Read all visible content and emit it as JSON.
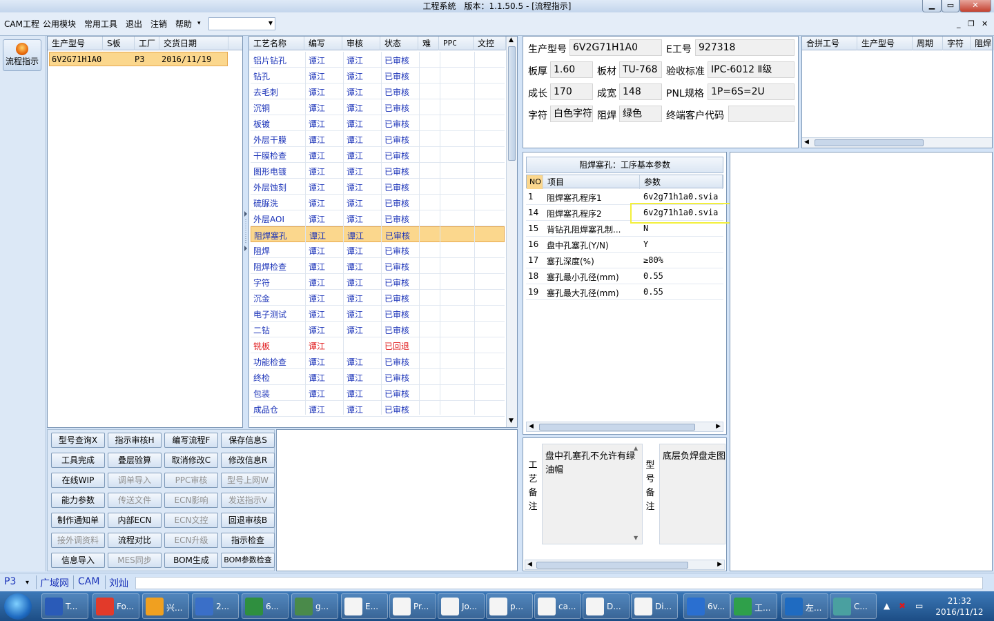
{
  "window": {
    "title": "工程系统　版本：1.1.50.5 - [流程指示]",
    "min_label": "▁",
    "max_label": "▭",
    "close_label": "✕"
  },
  "menu": {
    "items": [
      "CAM工程",
      "公用模块",
      "常用工具",
      "退出",
      "注销",
      "帮助"
    ],
    "help_arrow": "▾",
    "combo_value": "",
    "mdi_min": "_",
    "mdi_restore": "❐",
    "mdi_close": "✕"
  },
  "left_toolbar": {
    "flow_button": "流程指示"
  },
  "product_list": {
    "columns": [
      "生产型号",
      "S板",
      "工厂",
      "交货日期"
    ],
    "rows": [
      {
        "model": "6V2G71H1A0",
        "s_board": "",
        "factory": "P3",
        "delivery": "2016/11/19"
      }
    ]
  },
  "process_table": {
    "columns": [
      "工艺名称",
      "编写",
      "审核",
      "状态",
      "难",
      "PPC",
      "文控"
    ],
    "selected_index": 11,
    "rows": [
      {
        "name": "铝片钻孔",
        "writer": "谭江",
        "reviewer": "谭江",
        "status": "已审核"
      },
      {
        "name": "钻孔",
        "writer": "谭江",
        "reviewer": "谭江",
        "status": "已审核"
      },
      {
        "name": "去毛刺",
        "writer": "谭江",
        "reviewer": "谭江",
        "status": "已审核"
      },
      {
        "name": "沉铜",
        "writer": "谭江",
        "reviewer": "谭江",
        "status": "已审核"
      },
      {
        "name": "板镀",
        "writer": "谭江",
        "reviewer": "谭江",
        "status": "已审核"
      },
      {
        "name": "外层干膜",
        "writer": "谭江",
        "reviewer": "谭江",
        "status": "已审核"
      },
      {
        "name": "干膜检查",
        "writer": "谭江",
        "reviewer": "谭江",
        "status": "已审核"
      },
      {
        "name": "图形电镀",
        "writer": "谭江",
        "reviewer": "谭江",
        "status": "已审核"
      },
      {
        "name": "外层蚀刻",
        "writer": "谭江",
        "reviewer": "谭江",
        "status": "已审核"
      },
      {
        "name": "硫脲洗",
        "writer": "谭江",
        "reviewer": "谭江",
        "status": "已审核"
      },
      {
        "name": "外层AOI",
        "writer": "谭江",
        "reviewer": "谭江",
        "status": "已审核"
      },
      {
        "name": "阻焊塞孔",
        "writer": "谭江",
        "reviewer": "谭江",
        "status": "已审核"
      },
      {
        "name": "阻焊",
        "writer": "谭江",
        "reviewer": "谭江",
        "status": "已审核"
      },
      {
        "name": "阻焊检查",
        "writer": "谭江",
        "reviewer": "谭江",
        "status": "已审核"
      },
      {
        "name": "字符",
        "writer": "谭江",
        "reviewer": "谭江",
        "status": "已审核"
      },
      {
        "name": "沉金",
        "writer": "谭江",
        "reviewer": "谭江",
        "status": "已审核"
      },
      {
        "name": "电子测试",
        "writer": "谭江",
        "reviewer": "谭江",
        "status": "已审核"
      },
      {
        "name": "二钻",
        "writer": "谭江",
        "reviewer": "谭江",
        "status": "已审核"
      },
      {
        "name": "铣板",
        "writer": "谭江",
        "reviewer": "",
        "status": "已回退",
        "returned": true
      },
      {
        "name": "功能检查",
        "writer": "谭江",
        "reviewer": "谭江",
        "status": "已审核"
      },
      {
        "name": "终检",
        "writer": "谭江",
        "reviewer": "谭江",
        "status": "已审核"
      },
      {
        "name": "包装",
        "writer": "谭江",
        "reviewer": "谭江",
        "status": "已审核"
      },
      {
        "name": "成品仓",
        "writer": "谭江",
        "reviewer": "谭江",
        "status": "已审核"
      }
    ]
  },
  "info": {
    "prod_model_label": "生产型号",
    "prod_model": "6V2G71H1A0",
    "e_no_label": "E工号",
    "e_no": "927318",
    "thickness_label": "板厚",
    "thickness": "1.60",
    "material_label": "板材",
    "material": "TU-768",
    "standard_label": "验收标准",
    "standard": "IPC-6012 Ⅱ级",
    "length_label": "成长",
    "length": "170",
    "width_label": "成宽",
    "width": "148",
    "pnl_label": "PNL规格",
    "pnl": "1P=6S=2U",
    "char_label": "字符",
    "char": "白色字符",
    "mask_label": "阻焊",
    "mask": "绿色",
    "customer_label": "终端客户代码",
    "customer": ""
  },
  "combine_table": {
    "columns": [
      "合拼工号",
      "生产型号",
      "周期",
      "字符",
      "阻焊"
    ]
  },
  "params": {
    "title": "阻焊塞孔：工序基本参数",
    "columns": [
      "NO",
      "项目",
      "参数"
    ],
    "rows": [
      {
        "no": "1",
        "item": "阻焊塞孔程序1",
        "value": "6v2g71h1a0.svia"
      },
      {
        "no": "14",
        "item": "阻焊塞孔程序2",
        "value": "6v2g71h1a0.svia"
      },
      {
        "no": "15",
        "item": "背钻孔阻焊塞孔制...",
        "value": "N"
      },
      {
        "no": "16",
        "item": "盘中孔塞孔(Y/N)",
        "value": "Y"
      },
      {
        "no": "17",
        "item": "塞孔深度(%)",
        "value": "≥80%"
      },
      {
        "no": "18",
        "item": "塞孔最小孔径(mm)",
        "value": "0.55"
      },
      {
        "no": "19",
        "item": "塞孔最大孔径(mm)",
        "value": "0.55"
      }
    ]
  },
  "remarks": {
    "process_label": "工艺备注",
    "process_note": "盘中孔塞孔不允许有绿油帽",
    "model_label": "型号备注",
    "model_note": "底层负焊盘走图"
  },
  "buttons": [
    [
      "型号查询X",
      "指示审核H",
      "编写流程F",
      "保存信息S"
    ],
    [
      "工具完成",
      "叠层验算",
      "取消修改C",
      "修改信息R"
    ],
    [
      "在线WIP",
      "调单导入",
      "PPC审核",
      "型号上网W"
    ],
    [
      "能力参数",
      "传送文件",
      "ECN影响",
      "发送指示V"
    ],
    [
      "制作通知单",
      "内部ECN",
      "ECN文控",
      "回退审核B"
    ],
    [
      "接外调资料",
      "流程对比",
      "ECN升级",
      "指示检查"
    ],
    [
      "信息导入",
      "MES同步",
      "BOM生成",
      "BOM参数检查"
    ]
  ],
  "disabled_buttons": [
    "调单导入",
    "PPC审核",
    "型号上网W",
    "传送文件",
    "ECN影响",
    "发送指示V",
    "ECN文控",
    "接外调资料",
    "ECN升级",
    "MES同步"
  ],
  "status_bar": {
    "factory": "P3",
    "arrow": "▾",
    "network": "广域网",
    "module": "CAM",
    "user": "刘灿"
  },
  "taskbar": {
    "items": [
      "T...",
      "Fo...",
      "兴...",
      "2...",
      "6...",
      "g...",
      "E...",
      "Pr...",
      "Jo...",
      "p...",
      "ca...",
      "D...",
      "Di...",
      "6v...",
      "工...",
      "左...",
      "C..."
    ],
    "time": "21:32",
    "date": "2016/11/12"
  },
  "colors": {
    "selected_row": "#fbd78d",
    "link_text": "#1a32b8",
    "returned_text": "#e0181a",
    "highlight_box": "#f3ef3b"
  }
}
